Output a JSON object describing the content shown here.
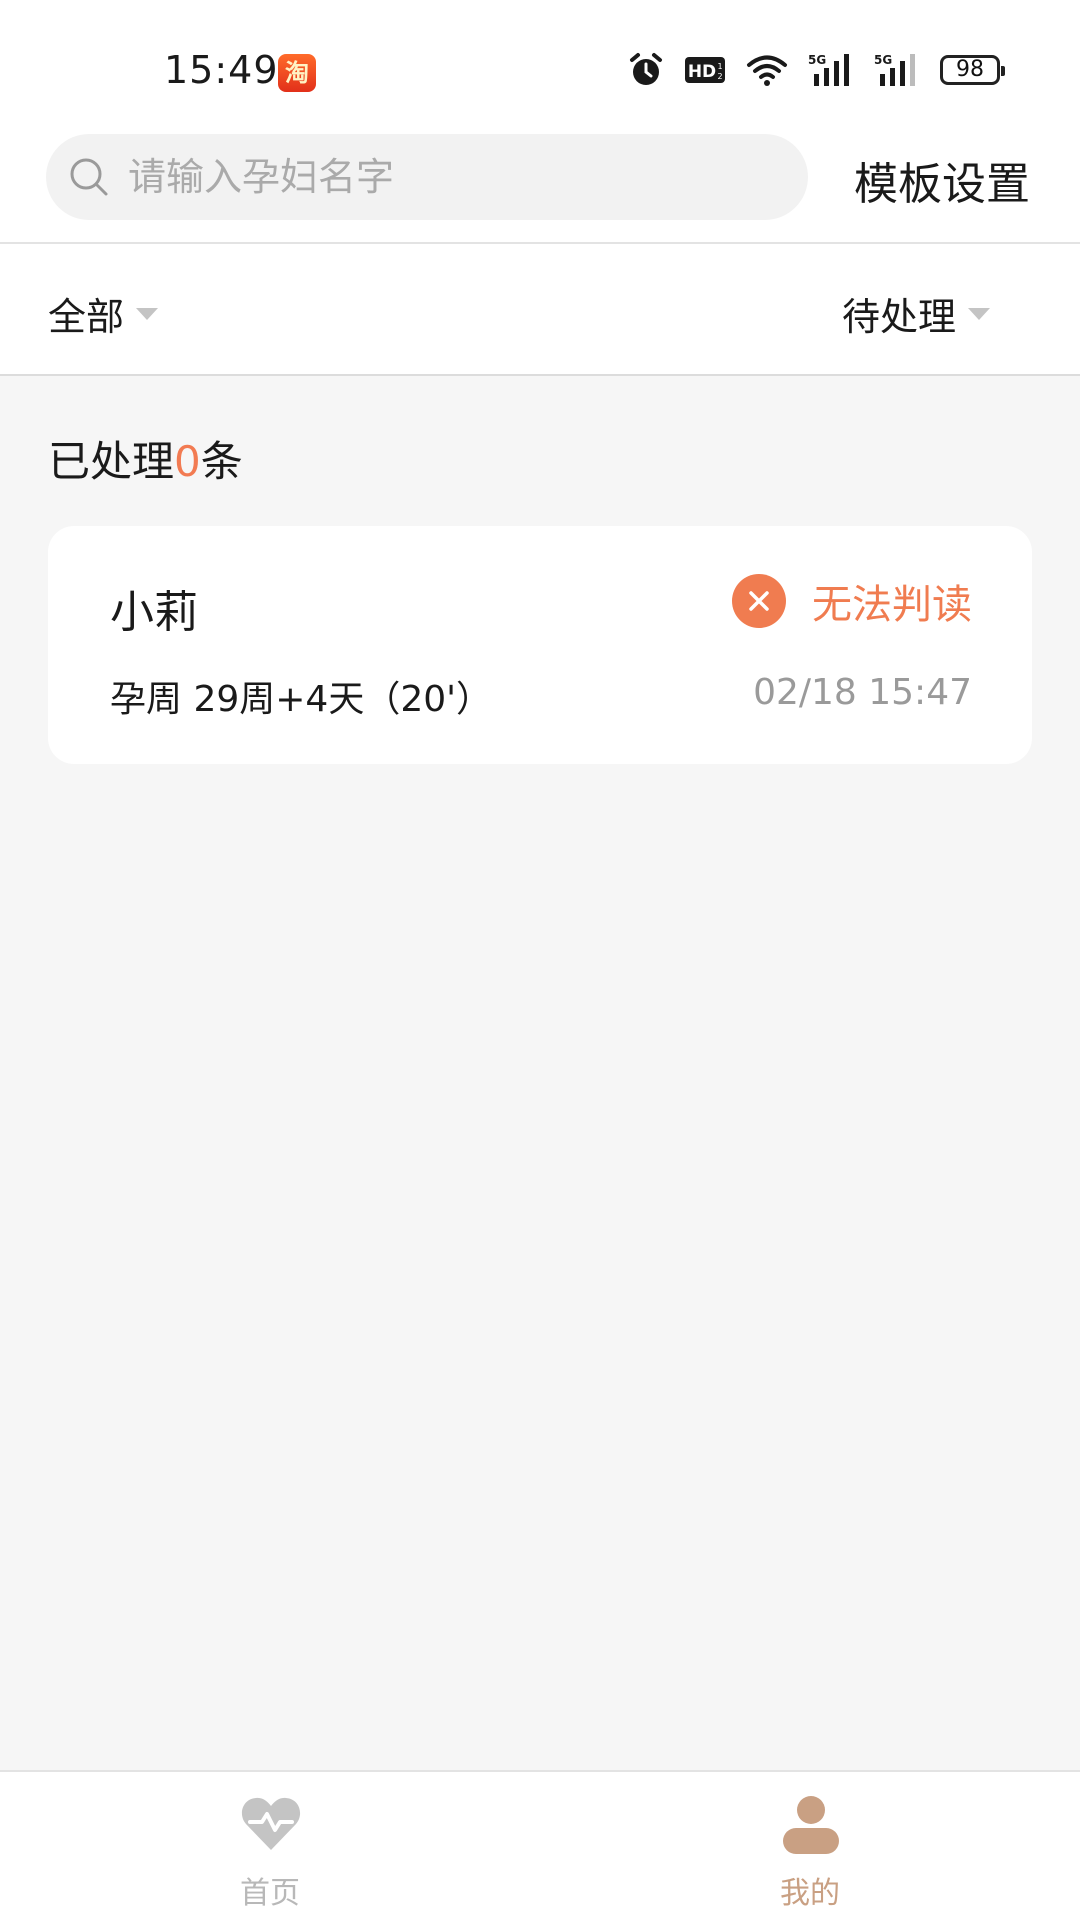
{
  "status_bar": {
    "time": "15:49",
    "app_badge": "淘",
    "battery": "98",
    "network_1": "5G",
    "network_2": "5G",
    "hd_label": "HD"
  },
  "search": {
    "placeholder": "请输入孕妇名字",
    "value": ""
  },
  "header": {
    "template_label": "模板设置"
  },
  "filters": {
    "all_label": "全部",
    "status_label": "待处理"
  },
  "summary": {
    "prefix": "已处理",
    "count": "0",
    "suffix": "条"
  },
  "records": [
    {
      "name": "小莉",
      "status": "无法判读",
      "gestation": "孕周 29周+4天（20'）",
      "time": "02/18 15:47"
    }
  ],
  "nav": {
    "home_label": "首页",
    "mine_label": "我的"
  },
  "colors": {
    "accent": "#f07c50",
    "nav_active": "#c9a083",
    "nav_inactive": "#c4c4c4",
    "background": "#f6f6f6"
  }
}
